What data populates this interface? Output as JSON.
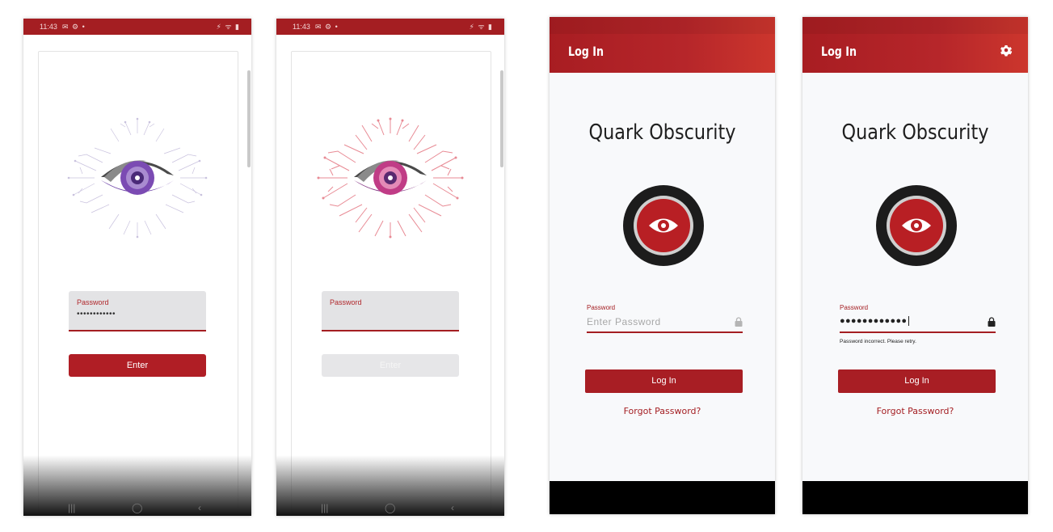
{
  "screens": [
    {
      "status_time": "11:43",
      "status_icons": "⁠✉ ⚙ •",
      "status_right": "⚡ ᯤ ▮",
      "password_label": "Password",
      "password_value": "••••••••••••",
      "button_label": "Enter",
      "button_state": "enabled",
      "logo_color": "purple"
    },
    {
      "status_time": "11:43",
      "status_icons": "⁠✉ ⚙ •",
      "status_right": "⚡ ᯤ ▮",
      "password_label": "Password",
      "password_value": "",
      "button_label": "Enter",
      "button_state": "disabled",
      "logo_color": "pink"
    },
    {
      "appbar_title": "Log In",
      "app_name": "Quark Obscurity",
      "password_label": "Password",
      "password_placeholder": "Enter Password",
      "login_label": "Log In",
      "forgot_label": "Forgot Password?"
    },
    {
      "appbar_title": "Log In",
      "app_name": "Quark Obscurity",
      "password_label": "Password",
      "password_value": "●●●●●●●●●●●●",
      "error_text": "Password incorrect. Please retry.",
      "login_label": "Log In",
      "forgot_label": "Forgot Password?",
      "settings_icon": "gear-icon"
    }
  ],
  "nav": {
    "recent": "|||",
    "home": "◯",
    "back": "‹"
  },
  "colors": {
    "brand_red": "#a81e24",
    "status_red": "#a41e22",
    "purple": "#6a3ea1",
    "pink": "#e88a94"
  }
}
